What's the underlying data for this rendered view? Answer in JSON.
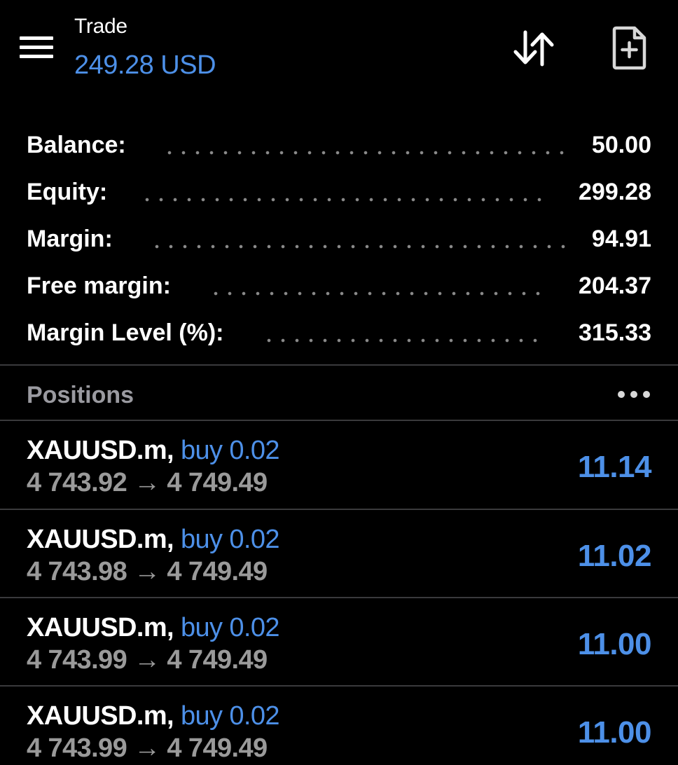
{
  "header": {
    "title": "Trade",
    "equity_display": "249.28 USD",
    "icons": {
      "menu": "hamburger-menu-icon",
      "sort": "sort-arrows-icon",
      "new_order": "new-order-document-icon"
    }
  },
  "summary": [
    {
      "label": "Balance:",
      "value": "50.00"
    },
    {
      "label": "Equity:",
      "value": "299.28"
    },
    {
      "label": "Margin:",
      "value": "94.91"
    },
    {
      "label": "Free margin:",
      "value": "204.37"
    },
    {
      "label": "Margin Level (%):",
      "value": "315.33"
    }
  ],
  "positions": {
    "title": "Positions",
    "more_icon": "more-dots-icon",
    "items": [
      {
        "symbol": "XAUUSD.m,",
        "side": "buy 0.02",
        "prices": "4 743.92 → 4 749.49",
        "profit": "11.14"
      },
      {
        "symbol": "XAUUSD.m,",
        "side": "buy 0.02",
        "prices": "4 743.98 → 4 749.49",
        "profit": "11.02"
      },
      {
        "symbol": "XAUUSD.m,",
        "side": "buy 0.02",
        "prices": "4 743.99 → 4 749.49",
        "profit": "11.00"
      },
      {
        "symbol": "XAUUSD.m,",
        "side": "buy 0.02",
        "prices": "4 743.99 → 4 749.49",
        "profit": "11.00"
      }
    ]
  },
  "colors": {
    "background": "#000000",
    "accent_blue": "#4d90e8",
    "text_primary": "#ffffff",
    "text_secondary": "#9a9a9a",
    "divider": "#3a3a3c"
  }
}
